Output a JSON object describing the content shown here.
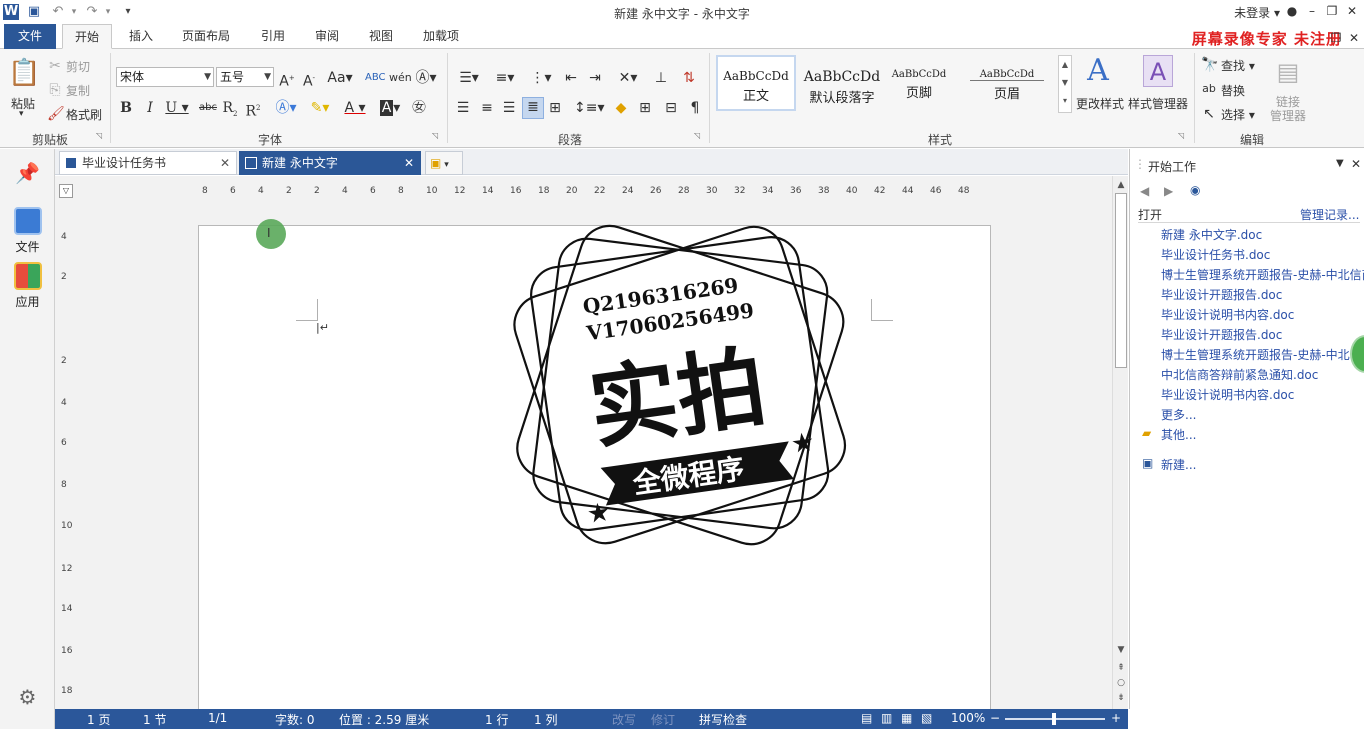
{
  "window": {
    "title": "新建 永中文字 - 永中文字",
    "login": "未登录",
    "watermark": "屏幕录像专家 未注册"
  },
  "ribbon_tabs": [
    "文件",
    "开始",
    "插入",
    "页面布局",
    "引用",
    "审阅",
    "视图",
    "加载项"
  ],
  "clipboard": {
    "paste": "粘贴",
    "cut": "剪切",
    "copy": "复制",
    "format_painter": "格式刷",
    "label": "剪贴板"
  },
  "font": {
    "name": "宋体",
    "size": "五号",
    "label": "字体"
  },
  "paragraph": {
    "label": "段落"
  },
  "styles": {
    "label": "样式",
    "cards": [
      {
        "sample": "AaBbCcDd",
        "name": "正文"
      },
      {
        "sample": "AaBbCcDd",
        "name": "默认段落字"
      },
      {
        "sample": "AaBbCcDd",
        "name": "页脚"
      },
      {
        "sample": "AaBbCcDd",
        "name": "页眉"
      }
    ],
    "change_style": "更改样式",
    "style_manager": "样式管理器"
  },
  "editing": {
    "label": "编辑",
    "find": "查找",
    "replace": "替换",
    "select": "选择",
    "link_manager": "链接\n管理器"
  },
  "left_nav": {
    "file": "文件",
    "apps": "应用"
  },
  "doc_tabs": [
    {
      "label": "毕业设计任务书",
      "active": false
    },
    {
      "label": "新建 永中文字",
      "active": true
    }
  ],
  "ruler": {
    "h_ticks": [
      "8",
      "6",
      "4",
      "2",
      "2",
      "4",
      "6",
      "8",
      "10",
      "12",
      "14",
      "16",
      "18",
      "20",
      "22",
      "24",
      "26",
      "28",
      "30",
      "32",
      "34",
      "36",
      "38",
      "40",
      "42",
      "44",
      "46",
      "48"
    ],
    "v_ticks": [
      "4",
      "2",
      "2",
      "4",
      "6",
      "8",
      "10",
      "12",
      "14",
      "16",
      "18"
    ]
  },
  "stamp": {
    "line1": "Q2196316269",
    "line2": "V17060256499",
    "main": "实拍",
    "banner": "全微程序"
  },
  "task_pane": {
    "title": "开始工作",
    "open": "打开",
    "manage": "管理记录...",
    "files": [
      "新建 永中文字.doc",
      "毕业设计任务书.doc",
      "博士生管理系统开题报告-史赫-中北信商",
      "毕业设计开题报告.doc",
      "毕业设计说明书内容.doc",
      "毕业设计开题报告.doc",
      "博士生管理系统开题报告-史赫-中北信商",
      "中北信商答辩前紧急通知.doc",
      "毕业设计说明书内容.doc"
    ],
    "more": "更多...",
    "other": "其他...",
    "new": "新建..."
  },
  "status": {
    "page": "1 页",
    "section": "1 节",
    "pages": "1/1",
    "words": "字数: 0",
    "position": "位置 : 2.59 厘米",
    "line": "1 行",
    "column": "1 列",
    "overwrite": "改写",
    "revise": "修订",
    "spell": "拼写检查",
    "zoom": "100%"
  }
}
